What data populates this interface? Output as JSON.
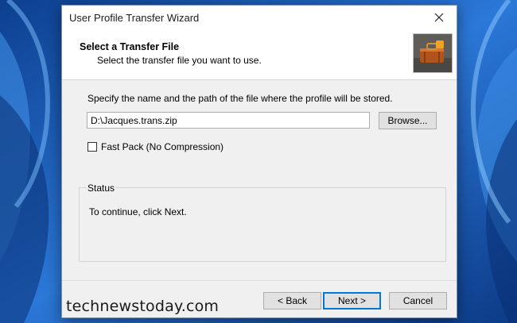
{
  "window": {
    "title": "User Profile Transfer Wizard",
    "close_glyph": "✕"
  },
  "header": {
    "title": "Select a Transfer File",
    "subtitle": "Select the transfer file you want to use.",
    "image_icon": "suitcase-image"
  },
  "form": {
    "instruction": "Specify the name and the path of the file where the profile will be stored.",
    "path_value": "D:\\Jacques.trans.zip",
    "browse_label": "Browse...",
    "fast_pack_label": "Fast Pack (No Compression)",
    "fast_pack_checked": false
  },
  "status": {
    "legend": "Status",
    "message": "To continue, click Next."
  },
  "buttons": {
    "back": "< Back",
    "next": "Next >",
    "cancel": "Cancel"
  },
  "watermark": "technewstoday.com",
  "colors": {
    "desktop": "#1f5fb8",
    "dialog_bg": "#f0f0f0",
    "accent": "#0078d7"
  }
}
